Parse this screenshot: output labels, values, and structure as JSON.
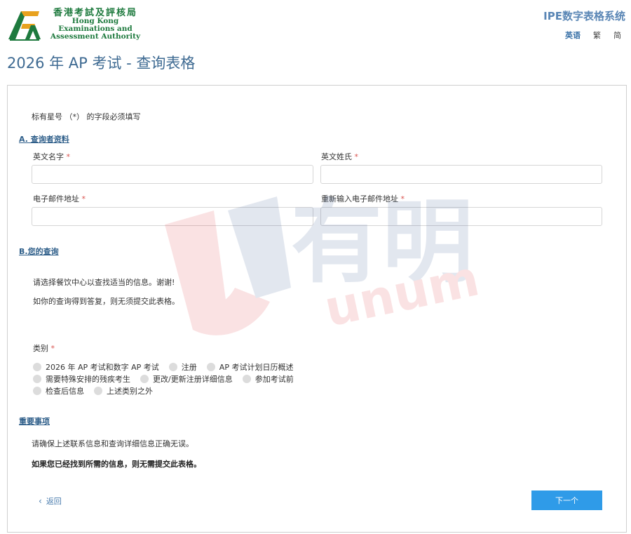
{
  "header": {
    "logo_cn": "香港考試及評核局",
    "logo_en_lines": [
      "Hong Kong",
      "Examinations and",
      "Assessment Authority"
    ],
    "system_title": "IPE数字表格系统",
    "languages": [
      "英语",
      "繁",
      "简"
    ]
  },
  "page_title": "2026 年 AP 考试 - 查询表格",
  "form": {
    "required_note": "标有星号 （*） 的字段必须填写",
    "section_a": {
      "title": "A. 查询者资料",
      "first_name_label": "英文名字",
      "last_name_label": "英文姓氏",
      "email_label": "电子邮件地址",
      "email_confirm_label": "重新输入电子邮件地址",
      "required_mark": "*",
      "first_name_value": "",
      "last_name_value": "",
      "email_value": "",
      "email_confirm_value": ""
    },
    "section_b": {
      "title": "B.您的查询",
      "instruction_1": "请选择餐饮中心以查找适当的信息。谢谢!",
      "instruction_2": "如你的查询得到答复，则无须提交此表格。",
      "category_label": "类别",
      "options": [
        "2026 年 AP 考试和数字 AP 考试",
        "注册",
        "AP 考试计划日历概述",
        "需要特殊安排的残疾考生",
        "更改/更新注册详细信息",
        "参加考试前",
        "检查后信息",
        "上述类别之外"
      ]
    },
    "important": {
      "title": "重要事项",
      "note_1": "请确保上述联系信息和查询详细信息正确无误。",
      "note_2": "如果您已经找到所需的信息，则无需提交此表格。"
    },
    "back_label": "返回",
    "next_label": "下一个"
  },
  "watermark_text": "有明",
  "watermark_sub": "unum",
  "colors": {
    "accent_blue": "#2f9be8",
    "title_blue": "#3e6a92",
    "logo_green": "#1e7a3e",
    "required_red": "#d9534f"
  }
}
